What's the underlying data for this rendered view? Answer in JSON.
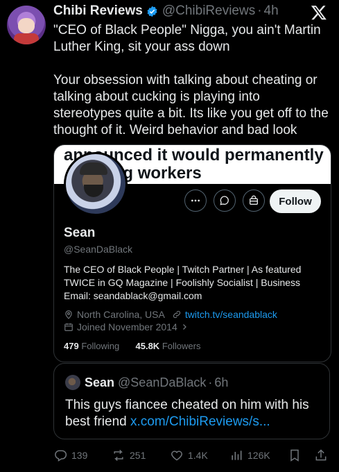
{
  "tweet": {
    "author_name": "Chibi Reviews",
    "author_handle": "@ChibiReviews",
    "separator": "·",
    "time": "4h",
    "paragraph1": "\"CEO of Black People\" Nigga, you ain't Martin Luther King, sit your ass down",
    "paragraph2": "Your obsession with talking about cheating or talking about cucking is playing into stereotypes quite a bit. Its like you get off to the thought of it. Weird behavior and bad look"
  },
  "profile_card": {
    "banner_text": "announced it would permanently\n  striking workers",
    "follow_label": "Follow",
    "name": "Sean",
    "handle": "@SeanDaBlack",
    "bio": "The CEO of Black People | Twitch Partner | As featured TWICE in GQ Magazine | Foolishly Socialist | Business Email: seandablack@gmail.com",
    "location": "North Carolina, USA",
    "link": "twitch.tv/seandablack",
    "joined": "Joined November 2014",
    "following_count": "479",
    "following_label": "Following",
    "followers_count": "45.8K",
    "followers_label": "Followers"
  },
  "quoted_tweet": {
    "author_name": "Sean",
    "author_handle": "@SeanDaBlack",
    "separator": "·",
    "time": "6h",
    "text": "This guys fiancee cheated on him with his best friend",
    "link": "x.com/ChibiReviews/s..."
  },
  "actions": {
    "replies": "139",
    "reposts": "251",
    "likes": "1.4K",
    "views": "126K"
  },
  "icons": [
    "verified-icon",
    "x-logo-icon",
    "more-icon",
    "message-icon",
    "notification-icon",
    "location-icon",
    "link-icon",
    "calendar-icon",
    "reply-icon",
    "repost-icon",
    "like-icon",
    "views-icon",
    "bookmark-icon",
    "share-icon"
  ],
  "colors": {
    "accent": "#1d9bf0",
    "muted": "#71767b",
    "text": "#e7e9ea",
    "background": "#000000"
  }
}
